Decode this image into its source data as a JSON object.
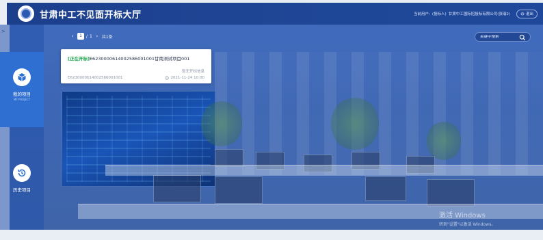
{
  "header": {
    "app_title": "甘肃中工不见面开标大厅",
    "user_label": "当前用户:",
    "user_role": "(投标人)",
    "user_name": "甘肃中工国际招投标有限公司(张瑞2)",
    "exit_label": "退出"
  },
  "sidebar": {
    "items": [
      {
        "label": "我的项目",
        "sub": "MY PROJECT",
        "icon": "cube-icon",
        "active": true
      },
      {
        "label": "历史项目",
        "sub": "",
        "icon": "history-icon",
        "active": false
      }
    ]
  },
  "pagination": {
    "current": "1",
    "separator": "/",
    "total_pages": "1",
    "total_text": "共1条"
  },
  "search": {
    "placeholder": "关键字搜索"
  },
  "card": {
    "status": "[正在开标]",
    "title": "E6230000614002586001001甘南测试项目001",
    "state_text": "暂无开标信息",
    "code": "E6230000614002586001001",
    "time": "2021-11-24 10:00"
  },
  "watermark": {
    "line1": "激活 Windows",
    "line2": "转到\"设置\"以激活 Windows。"
  },
  "colors": {
    "header": "#1f4797",
    "active_nav": "#2f6fd1",
    "status_green": "#1aa54a"
  }
}
